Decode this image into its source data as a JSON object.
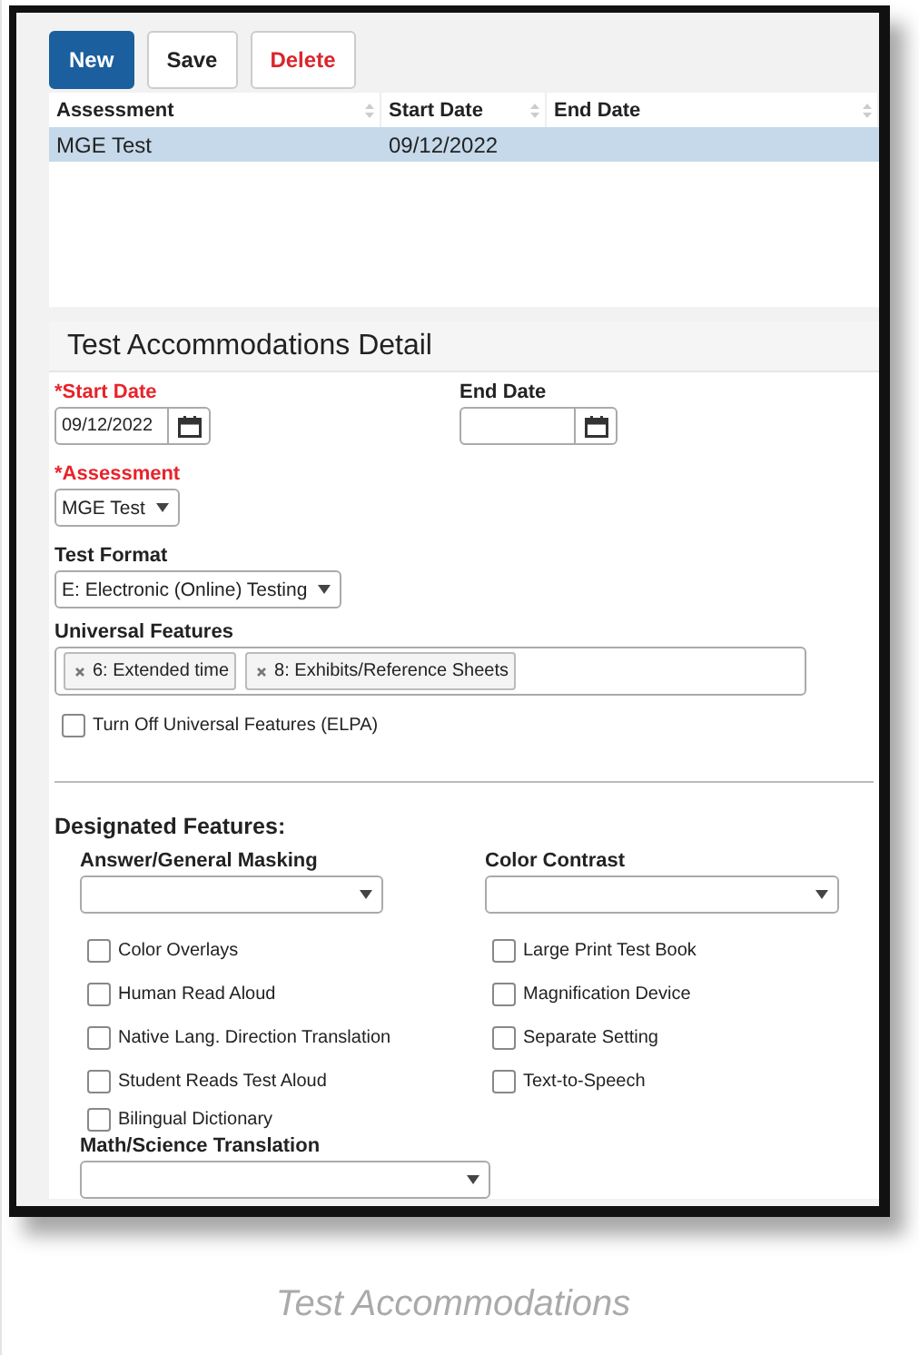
{
  "toolbar": {
    "buttons": [
      {
        "label": "New",
        "kind": "primary"
      },
      {
        "label": "Save",
        "kind": "default"
      },
      {
        "label": "Delete",
        "kind": "danger"
      }
    ]
  },
  "table": {
    "columns": [
      {
        "label": "Assessment"
      },
      {
        "label": "Start Date"
      },
      {
        "label": "End Date"
      }
    ],
    "rows": [
      {
        "cells": [
          "MGE Test",
          "09/12/2022"
        ],
        "selected": true
      }
    ]
  },
  "detail": {
    "title": "Test Accommodations Detail",
    "start_date": {
      "label": "*Start Date",
      "required": true,
      "value": "09/12/2022"
    },
    "end_date": {
      "label": "End Date",
      "required": false
    },
    "assessment": {
      "label": "*Assessment",
      "required": true,
      "value": "MGE Test"
    },
    "test_format": {
      "label": "Test Format",
      "required": false,
      "value": "E: Electronic (Online) Testing"
    },
    "universal_features": {
      "label": "Universal Features",
      "tags": [
        "6: Extended time",
        "8: Exhibits/Reference Sheets"
      ]
    },
    "turn_off": {
      "label": "Turn Off Universal Features (ELPA)",
      "checked": false
    }
  },
  "designated": {
    "title": "Designated Features:",
    "selects": [
      {
        "label": "Answer/General Masking"
      },
      {
        "label": "Color Contrast"
      }
    ],
    "left_checkboxes": [
      {
        "label": "Color Overlays",
        "checked": false
      },
      {
        "label": "Human Read Aloud",
        "checked": false
      },
      {
        "label": "Native Lang. Direction Translation",
        "checked": false
      },
      {
        "label": "Student Reads Test Aloud",
        "checked": false
      },
      {
        "label": "Bilingual Dictionary",
        "checked": false
      }
    ],
    "right_checkboxes": [
      {
        "label": "Large Print Test Book",
        "checked": false
      },
      {
        "label": "Magnification Device",
        "checked": false
      },
      {
        "label": "Separate Setting",
        "checked": false
      },
      {
        "label": "Text-to-Speech",
        "checked": false
      }
    ],
    "math_select": {
      "label": "Math/Science Translation"
    }
  },
  "caption": "Test Accommodations"
}
